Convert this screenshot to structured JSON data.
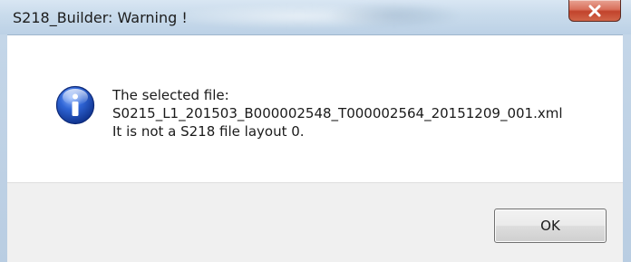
{
  "window": {
    "title": "S218_Builder: Warning !",
    "close_icon": "close-icon"
  },
  "message": {
    "icon": "info-icon",
    "line1": "The selected file:",
    "line2": "S0215_L1_201503_B000002548_T000002564_20151209_001.xml",
    "line3": "It is not a S218 file layout 0."
  },
  "buttons": {
    "ok_label": "OK"
  },
  "colors": {
    "titlebar": "#c8daec",
    "close_button": "#c94a32",
    "info_icon": "#1f4fb4",
    "footer": "#f0f0f0"
  }
}
